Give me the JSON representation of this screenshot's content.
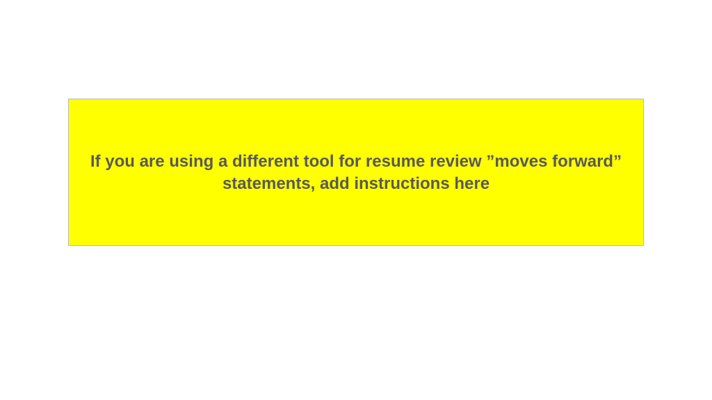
{
  "callout": {
    "text": "If you are using a different tool for resume review ”moves forward” statements, add instructions here"
  }
}
